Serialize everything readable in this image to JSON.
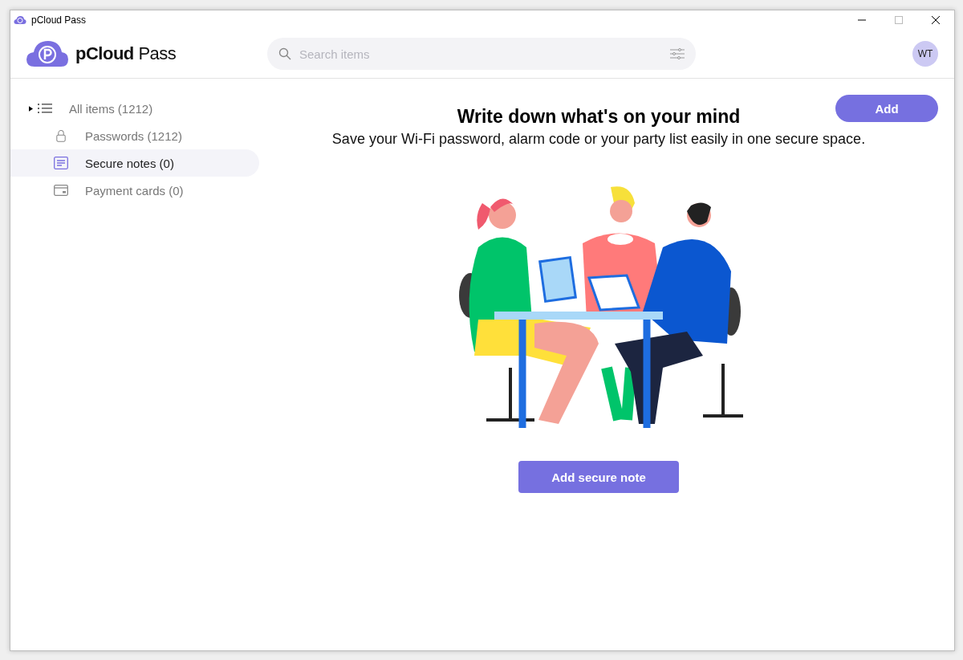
{
  "window": {
    "title": "pCloud Pass"
  },
  "header": {
    "logo_text_bold": "pCloud",
    "logo_text": "Pass",
    "search": {
      "placeholder": "Search items"
    },
    "avatar": "WT"
  },
  "sidebar": {
    "items": [
      {
        "kind": "all",
        "label": "All items (1212)",
        "selected": false,
        "expanded": false
      },
      {
        "kind": "passwords",
        "label": "Passwords (1212)",
        "selected": false
      },
      {
        "kind": "notes",
        "label": "Secure notes (0)",
        "selected": true
      },
      {
        "kind": "cards",
        "label": "Payment cards (0)",
        "selected": false
      }
    ]
  },
  "main": {
    "add_button": "Add",
    "title": "Write down what's on your mind",
    "subtitle": "Save your Wi-Fi password, alarm code or your party list easily in one secure space.",
    "action_button": "Add secure note"
  }
}
